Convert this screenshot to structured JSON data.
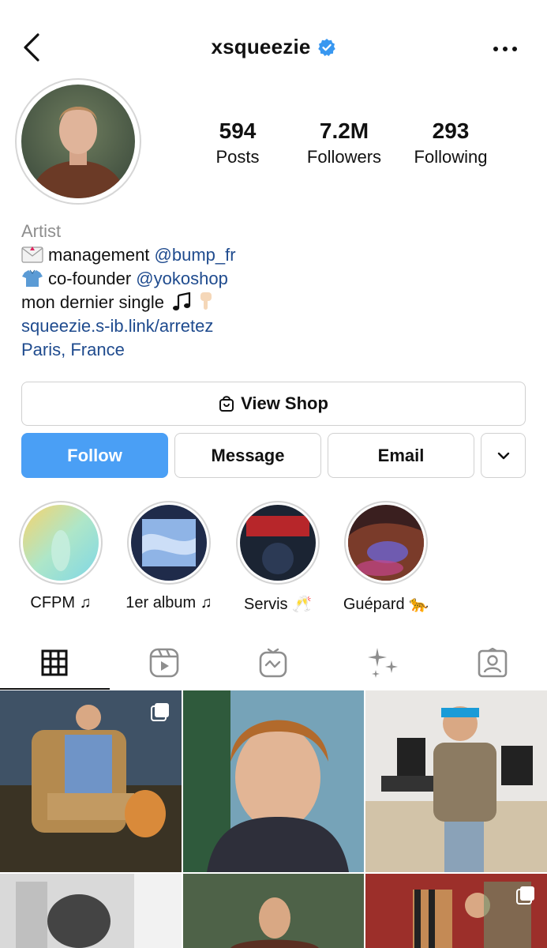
{
  "header": {
    "username": "xsqueezie",
    "back_icon": "chevron-left-icon",
    "verified_icon": "verified-badge-icon",
    "more_icon": "more-horizontal-icon",
    "verified_color": "#3897f0"
  },
  "stats": [
    {
      "value": "594",
      "label": "Posts"
    },
    {
      "value": "7.2M",
      "label": "Followers"
    },
    {
      "value": "293",
      "label": "Following"
    }
  ],
  "bio": {
    "category": "Artist",
    "line1_text": "management ",
    "line1_mention": "@bump_fr",
    "line2_text": "co-founder ",
    "line2_mention": "@yokoshop",
    "line3_text": "mon dernier single",
    "link": "squeezie.s-ib.link/arretez",
    "location": "Paris, France",
    "link_color": "#1f4b8e"
  },
  "buttons": {
    "view_shop": "View Shop",
    "follow": "Follow",
    "message": "Message",
    "email": "Email",
    "follow_color": "#4a9ff5"
  },
  "highlights": [
    {
      "label": "CFPM ♫"
    },
    {
      "label": "1er album ♫"
    },
    {
      "label": "Servis 🥂"
    },
    {
      "label": "Guépard 🐆"
    }
  ],
  "tabs": [
    {
      "icon": "grid-icon",
      "active": true
    },
    {
      "icon": "reels-icon",
      "active": false
    },
    {
      "icon": "igtv-icon",
      "active": false
    },
    {
      "icon": "sparkles-icon",
      "active": false
    },
    {
      "icon": "tagged-icon",
      "active": false
    }
  ]
}
